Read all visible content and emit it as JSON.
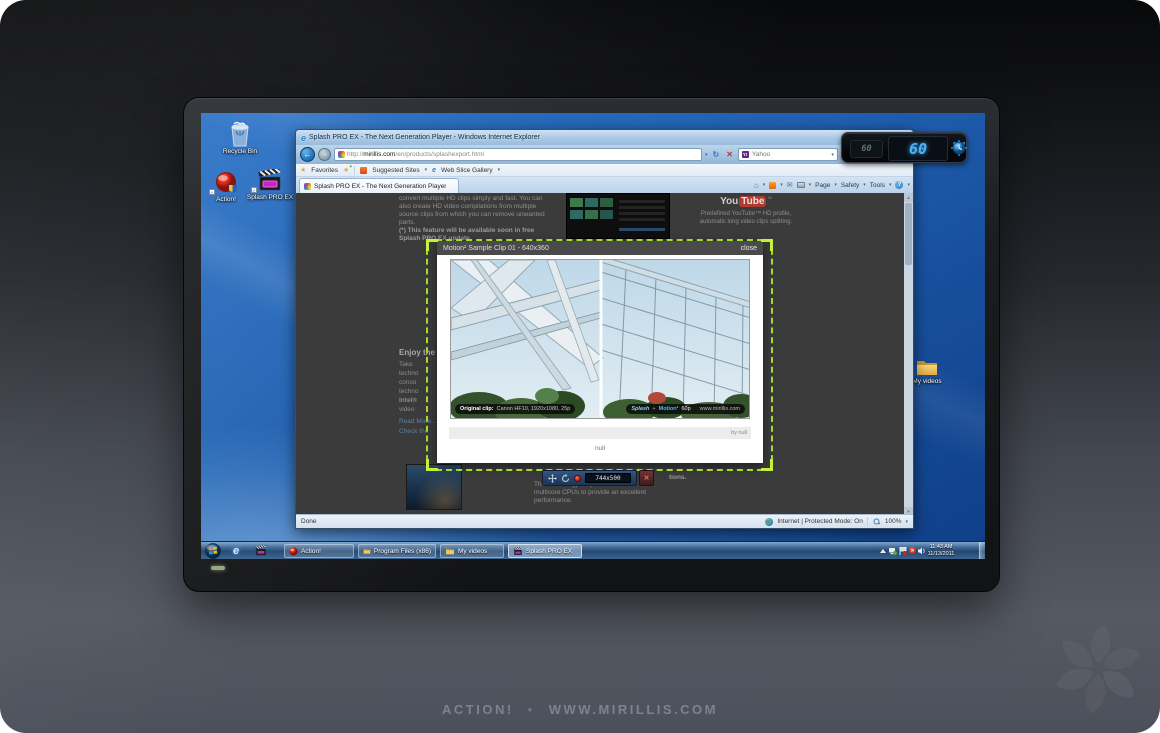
{
  "poster": {
    "brand": "ACTION!",
    "bullet": "•",
    "site": "WWW.MIRILLIS.COM"
  },
  "fps_hud": {
    "small_value": "60",
    "large_value": "60"
  },
  "desktop_icons": {
    "recycle_bin": "Recycle Bin",
    "action": "Action!",
    "splash": "Splash PRO EX",
    "my_videos": "My videos"
  },
  "browser": {
    "title": "Splash PRO EX - The Next Generation Player - Windows Internet Explorer",
    "url_prefix": "http://",
    "url_domain": "mirillis.com",
    "url_path": "/en/products/splashexport.html",
    "search_text": "Yahoo",
    "favorites": "Favorites",
    "suggested_sites": "Suggested Sites",
    "web_slice_gallery": "Web Slice Gallery",
    "tab_title": "Splash PRO EX - The Next Generation Player",
    "page_menu": "Page",
    "safety_menu": "Safety",
    "tools_menu": "Tools",
    "status_done": "Done",
    "status_zone": "Internet | Protected Mode: On",
    "status_zoom": "100%"
  },
  "webpage": {
    "para1": "convert multiple HD clips simply and fast. You can also create HD video compilations from multiple source clips from which you can remove unwanted parts.",
    "para1_note": "(*) This feature will be available soon in free Splash PRO EX update.",
    "youtube_you": "You",
    "youtube_tube": "Tube",
    "youtube_tm": "™",
    "youtube_caption": "Predefined YouTube™ HD profile, automatic long video clips splitting.",
    "heading_fragment": "Enjoy the",
    "fragments": [
      "Take",
      "techno",
      "conso",
      "techno",
      "Intel®",
      "video"
    ],
    "link1": "Read More...",
    "link2": "Check the",
    "perf_text": "The technology is optimized for multicore CPUs to provide an excellent performance.",
    "perf_fragment": "tions."
  },
  "lightbox": {
    "title": "Motion² Sample Clip 01 - 640x360",
    "close": "close",
    "clip_label": "Original clip:",
    "clip_value": "Canon HF10, 1920x1080, 25p",
    "brand": "Splash",
    "plus": "+",
    "tech": "Motion²",
    "fps": "60p",
    "site": "www.mirillis.com",
    "byline": "by null",
    "footer_text": "null"
  },
  "recorder": {
    "size": "744x500"
  },
  "taskbar": {
    "buttons": [
      {
        "label": "Action!"
      },
      {
        "label": "Program Files (x86)"
      },
      {
        "label": "My videos"
      },
      {
        "label": "Splash PRO EX"
      }
    ],
    "time": "11:43 AM",
    "date": "11/13/2011"
  },
  "colors": {
    "accent_green": "#a6da28",
    "record_red": "#d02818",
    "lcd_blue": "#4ab4f6",
    "desktop_blue": "#2263b4"
  }
}
